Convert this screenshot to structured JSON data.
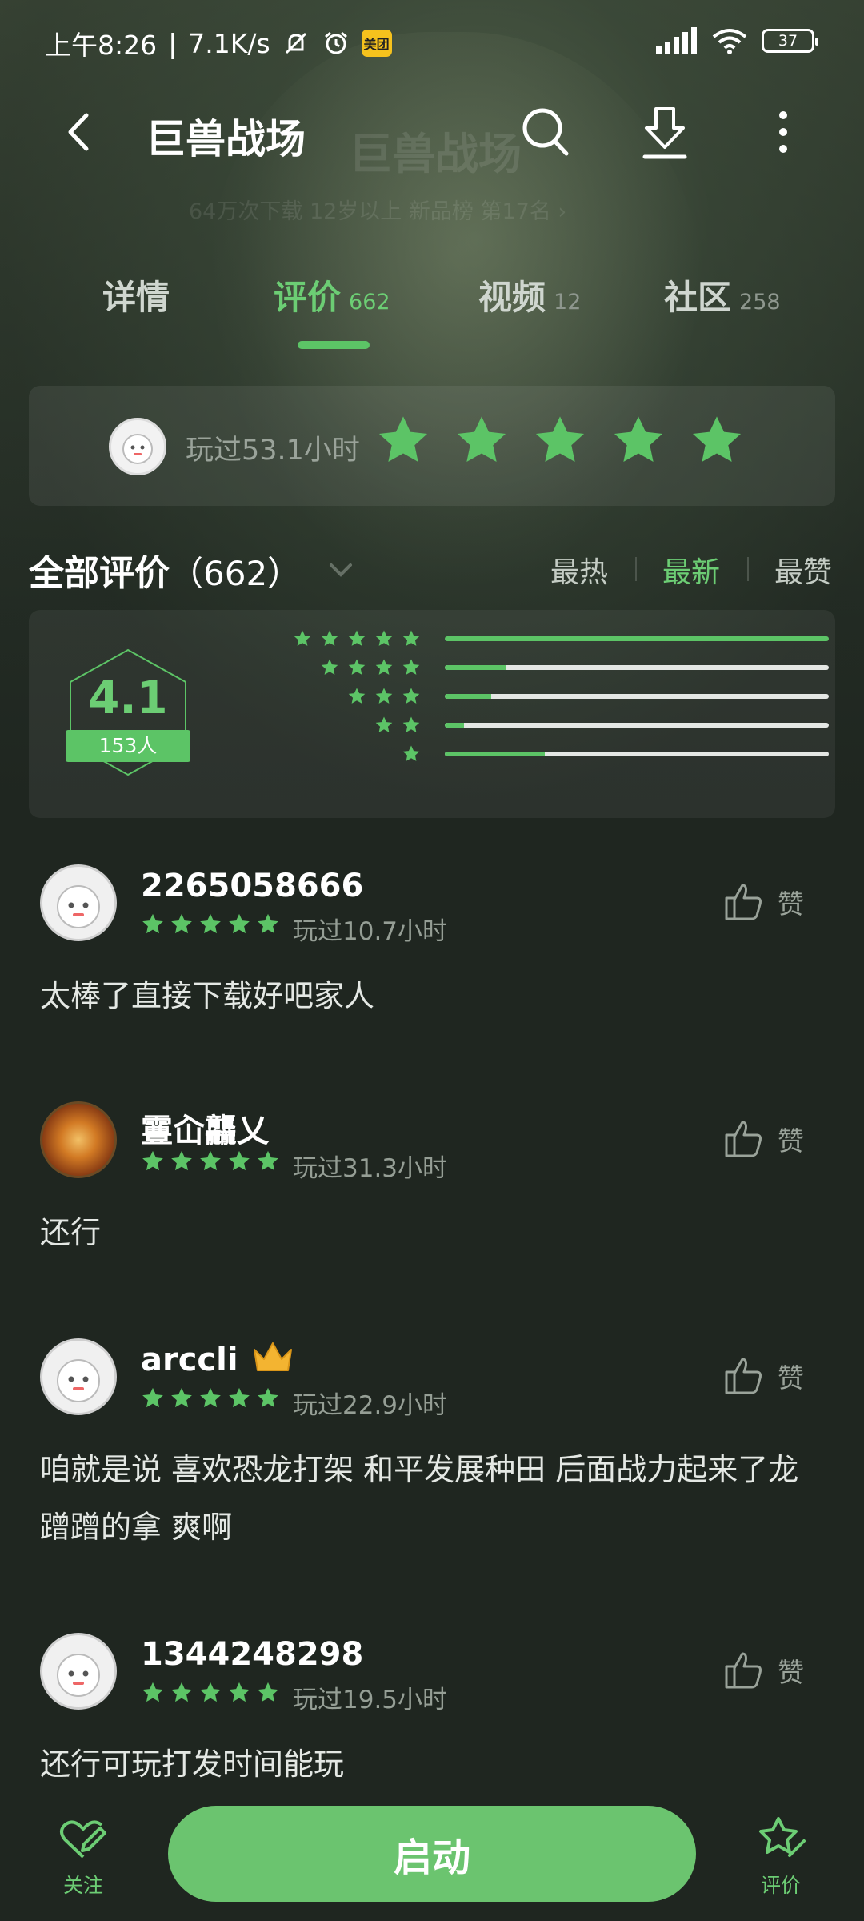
{
  "status_bar": {
    "time": "上午8:26",
    "speed": "7.1K/s",
    "meituan_label": "美团",
    "battery": "37"
  },
  "header": {
    "title": "巨兽战场",
    "ghost_meta": "64万次下载   12岁以上   新品榜 第17名 ›"
  },
  "tabs": [
    {
      "label": "详情",
      "count": ""
    },
    {
      "label": "评价",
      "count": "662"
    },
    {
      "label": "视频",
      "count": "12"
    },
    {
      "label": "社区",
      "count": "258"
    }
  ],
  "my_rating": {
    "playtime": "玩过53.1小时",
    "stars": 5
  },
  "reviews_header": {
    "title": "全部评价",
    "count": "（662）",
    "sort": [
      "最热",
      "最新",
      "最赞"
    ],
    "active_sort": "最新"
  },
  "summary": {
    "score": "4.1",
    "people": "153人",
    "distribution": [
      {
        "stars": 5,
        "fraction": 1.0
      },
      {
        "stars": 4,
        "fraction": 0.16
      },
      {
        "stars": 3,
        "fraction": 0.12
      },
      {
        "stars": 2,
        "fraction": 0.05
      },
      {
        "stars": 1,
        "fraction": 0.26
      }
    ]
  },
  "reviews": [
    {
      "name": "2265058666",
      "stars": 5,
      "playtime": "玩过10.7小时",
      "like_label": "赞",
      "text": "太棒了直接下载好吧家人",
      "avatar": "robot-avatar"
    },
    {
      "name": "霻屳龘乂",
      "stars": 5,
      "playtime": "玩过31.3小时",
      "like_label": "赞",
      "text": "还行",
      "avatar": "flower-avatar"
    },
    {
      "name": "arccli",
      "stars": 5,
      "playtime": "玩过22.9小时",
      "like_label": "赞",
      "text": "咱就是说 喜欢恐龙打架 和平发展种田 后面战力起来了龙蹭蹭的拿 爽啊",
      "avatar": "robot-avatar",
      "crown": true
    },
    {
      "name": "1344248298",
      "stars": 5,
      "playtime": "玩过19.5小时",
      "like_label": "赞",
      "text": "还行可玩打发时间能玩",
      "avatar": "robot-avatar"
    }
  ],
  "bottom_bar": {
    "follow_label": "关注",
    "start_label": "启动",
    "rate_label": "评价"
  },
  "colors": {
    "accent": "#6ccd74",
    "background": "#1f2620",
    "button": "#6bc46f"
  }
}
